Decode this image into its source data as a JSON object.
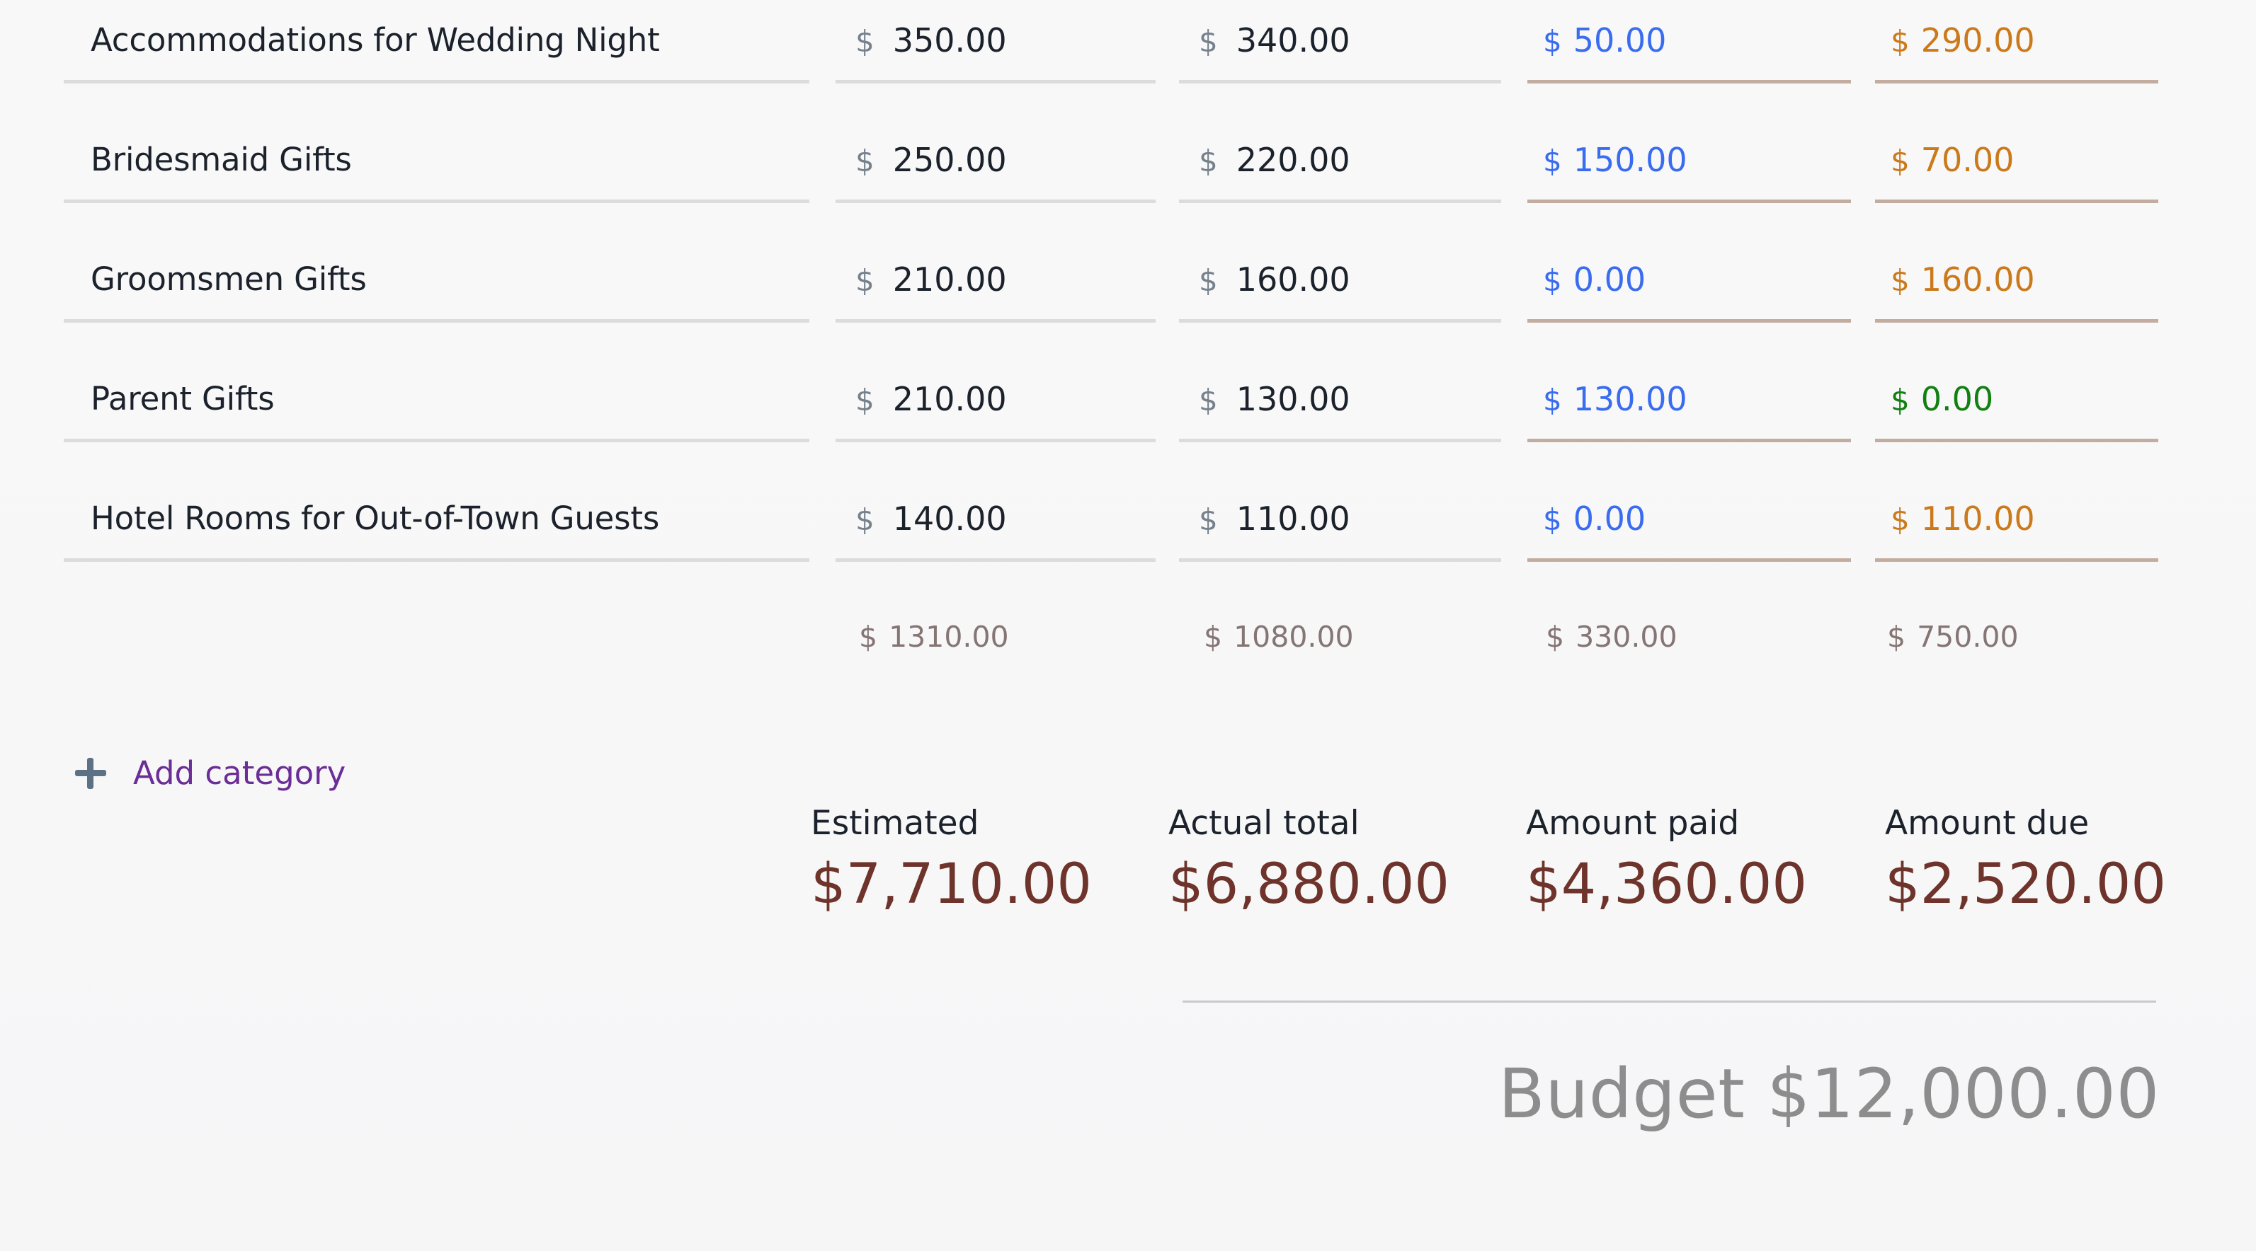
{
  "table": {
    "currency_symbol": "$",
    "rows": [
      {
        "name": "Accommodations for Wedding Night",
        "estimated": "350.00",
        "actual": "340.00",
        "paid": "50.00",
        "due": "290.00",
        "due_state": "outstanding"
      },
      {
        "name": "Bridesmaid Gifts",
        "estimated": "250.00",
        "actual": "220.00",
        "paid": "150.00",
        "due": "70.00",
        "due_state": "outstanding"
      },
      {
        "name": "Groomsmen Gifts",
        "estimated": "210.00",
        "actual": "160.00",
        "paid": "0.00",
        "due": "160.00",
        "due_state": "outstanding"
      },
      {
        "name": "Parent Gifts",
        "estimated": "210.00",
        "actual": "130.00",
        "paid": "130.00",
        "due": "0.00",
        "due_state": "settled"
      },
      {
        "name": "Hotel Rooms for Out-of-Town Guests",
        "estimated": "140.00",
        "actual": "110.00",
        "paid": "0.00",
        "due": "110.00",
        "due_state": "outstanding"
      }
    ],
    "subtotals": {
      "estimated": "1310.00",
      "actual": "1080.00",
      "paid": "330.00",
      "due": "750.00"
    }
  },
  "add_category": {
    "label": "Add category",
    "icon": "plus-icon"
  },
  "summary": {
    "estimated": {
      "label": "Estimated",
      "value": "$7,710.00"
    },
    "actual": {
      "label": "Actual total",
      "value": "$6,880.00"
    },
    "paid": {
      "label": "Amount paid",
      "value": "$4,360.00"
    },
    "due": {
      "label": "Amount due",
      "value": "$2,520.00"
    }
  },
  "budget": {
    "text": "Budget $12,000.00"
  },
  "colors": {
    "background": "#f7f7f8",
    "row_underline": "#dcdcdc",
    "accent_underline": "#c3ada0",
    "text_primary": "#1c222b",
    "currency_symbol": "#76818c",
    "paid": "#3a6cf0",
    "due_outstanding": "#cb7a1b",
    "due_settled": "#118011",
    "subtotal": "#857574",
    "summary_value": "#6e332b",
    "add_category_link": "#6b2d96",
    "plus_icon": "#5d7184",
    "budget_text": "#8d8d8d"
  }
}
